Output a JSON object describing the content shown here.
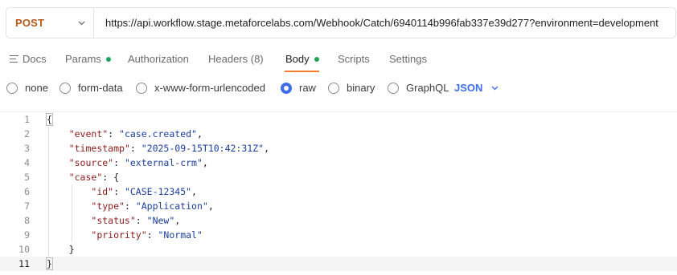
{
  "request": {
    "method": "POST",
    "url": "https://api.workflow.stage.metaforcelabs.com/Webhook/Catch/6940114b996fab337e39d277?environment=development"
  },
  "tabs": [
    {
      "label": "Docs"
    },
    {
      "label": "Params"
    },
    {
      "label": "Authorization"
    },
    {
      "label": "Headers (8)"
    },
    {
      "label": "Body"
    },
    {
      "label": "Scripts"
    },
    {
      "label": "Settings"
    }
  ],
  "body_types": {
    "options": [
      "none",
      "form-data",
      "x-www-form-urlencoded",
      "raw",
      "binary",
      "GraphQL"
    ],
    "selected": "raw",
    "language": "JSON"
  },
  "editor": {
    "line_numbers": [
      "1",
      "2",
      "3",
      "4",
      "5",
      "6",
      "7",
      "8",
      "9",
      "10",
      "11"
    ],
    "open_brace": "{",
    "close_brace": "}",
    "fields": {
      "event_key": "\"event\"",
      "event_value": "\"case.created\"",
      "timestamp_key": "\"timestamp\"",
      "timestamp_value": "\"2025-09-15T10:42:31Z\"",
      "source_key": "\"source\"",
      "source_value": "\"external-crm\"",
      "case_key": "\"case\"",
      "id_key": "\"id\"",
      "id_value": "\"CASE-12345\"",
      "type_key": "\"type\"",
      "type_value": "\"Application\"",
      "status_key": "\"status\"",
      "status_value": "\"New\"",
      "priority_key": "\"priority\"",
      "priority_value": "\"Normal\""
    }
  },
  "colors": {
    "method": "#b3591a",
    "accent": "#f27b2c",
    "dot": "#20a35a",
    "radio_checked": "#3f6ee8",
    "json_key": "#8c1b1b",
    "json_string": "#1a3e9c"
  }
}
